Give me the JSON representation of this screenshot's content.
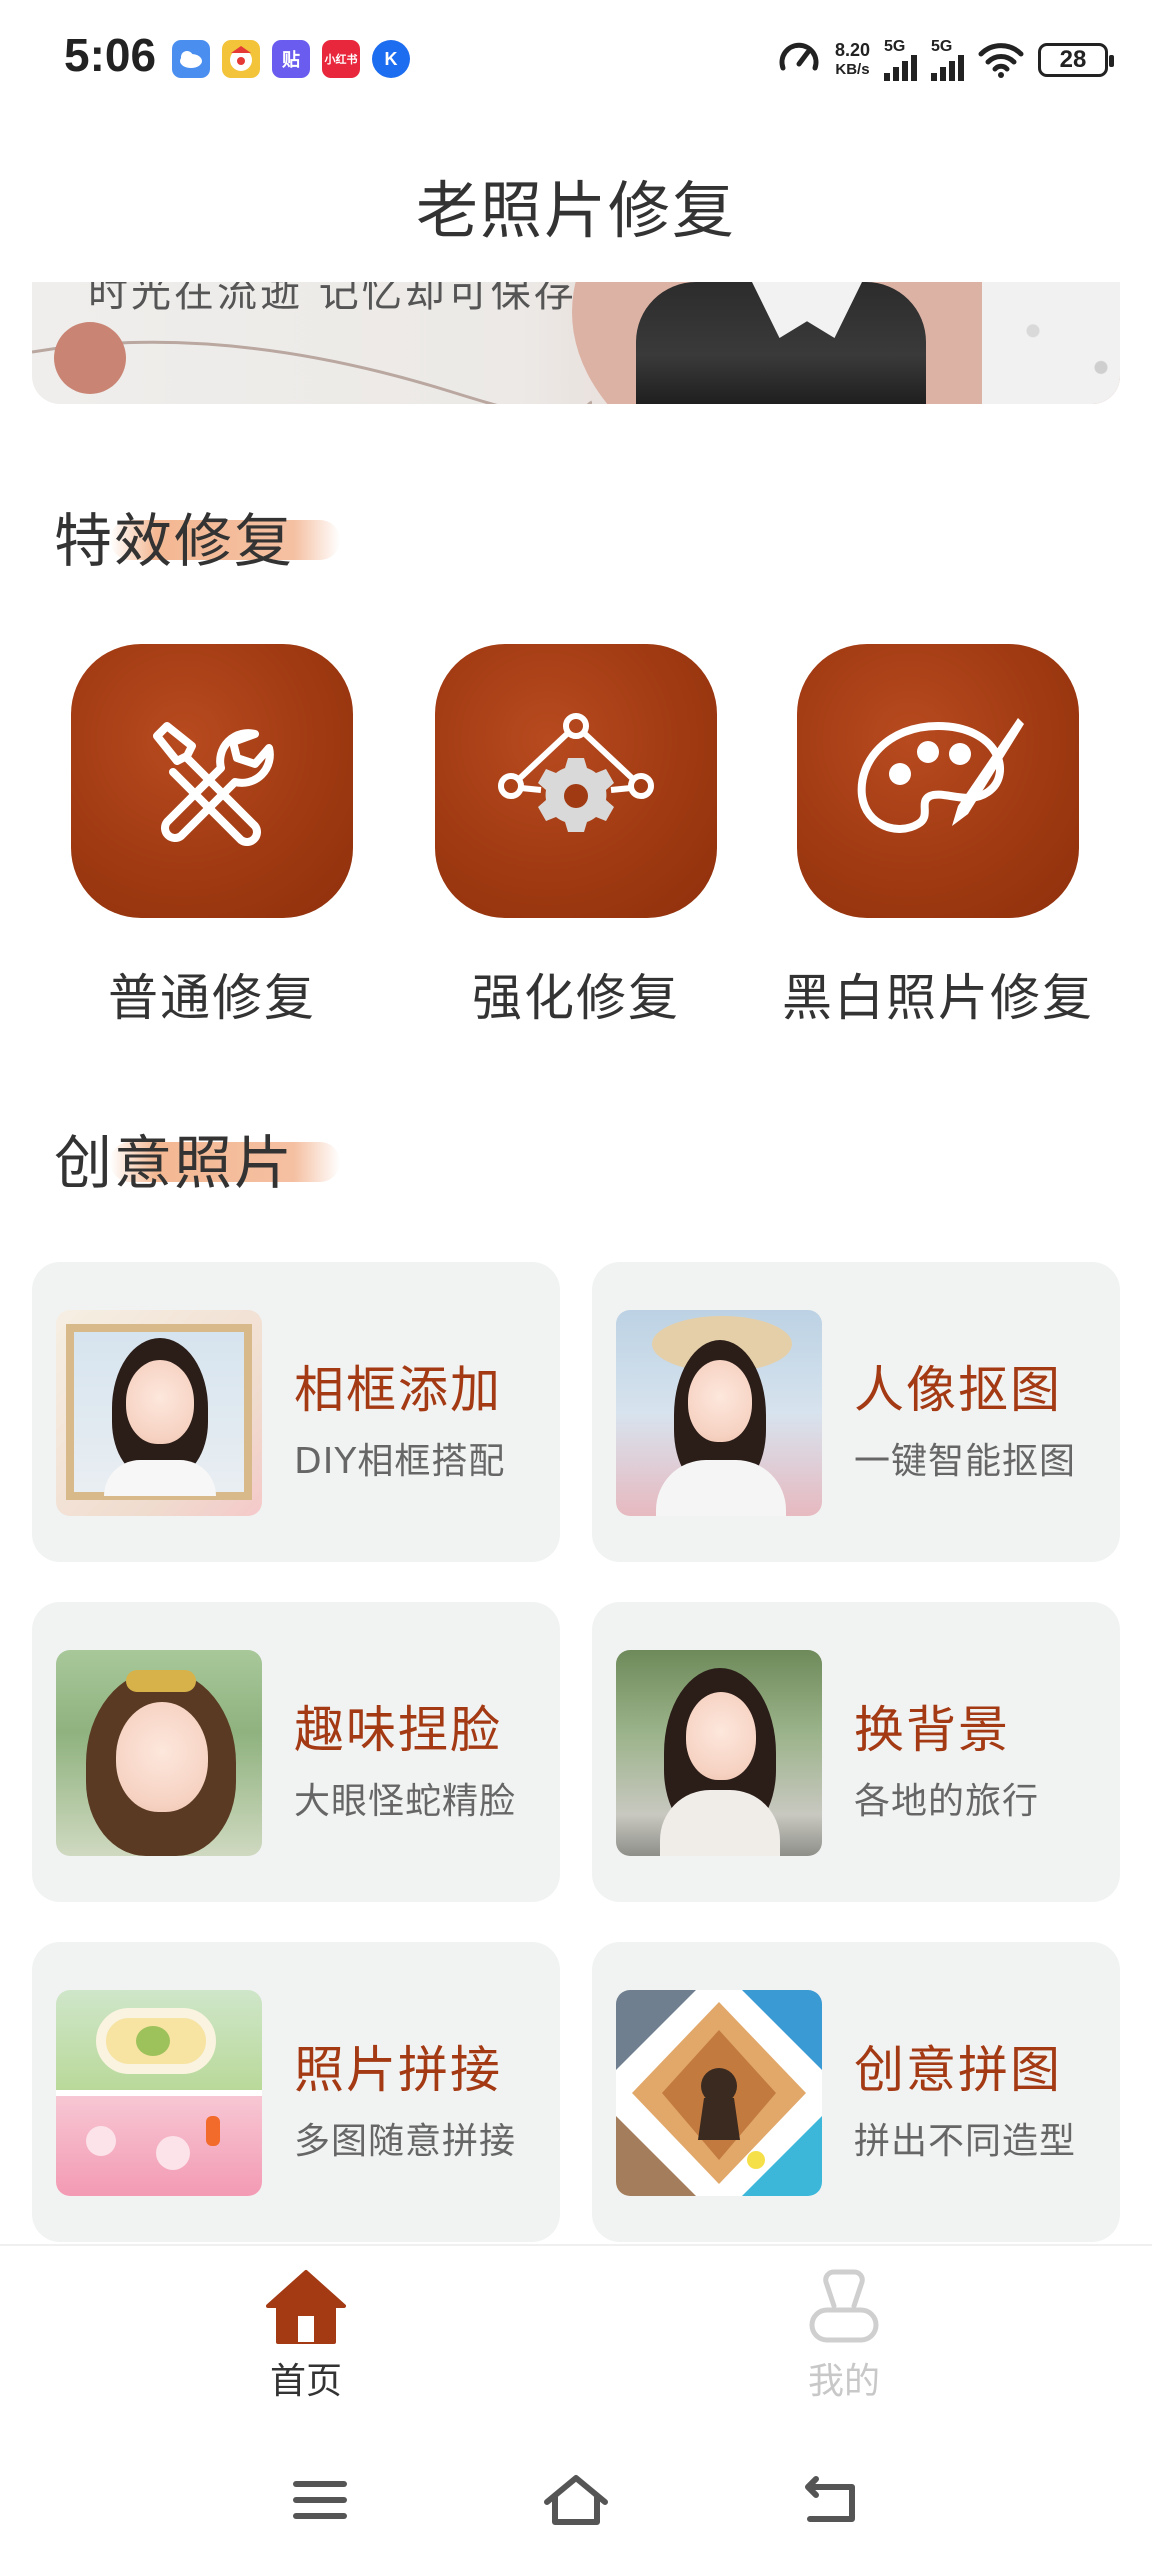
{
  "status_bar": {
    "time": "5:06",
    "net_speed_value": "8.20",
    "net_speed_unit": "KB/s",
    "sim1_label": "5G",
    "sim2_label": "5G",
    "battery": "28",
    "app_icons": [
      "weather-app-icon",
      "clown-app-icon",
      "tieba-app-icon",
      "xiaohongshu-app-icon",
      "k-app-icon"
    ],
    "xhs_icon_text": "小红书",
    "tie_icon_text": "贴",
    "k_icon_text": "K"
  },
  "header": {
    "title": "老照片修复"
  },
  "banner": {
    "text": "时光在流逝 记忆却可保存"
  },
  "sections": {
    "effects_title": "特效修复",
    "creative_title": "创意照片"
  },
  "effects": [
    {
      "label": "普通修复",
      "icon": "tools-icon"
    },
    {
      "label": "强化修复",
      "icon": "gear-network-icon"
    },
    {
      "label": "黑白照片修复",
      "icon": "palette-icon"
    }
  ],
  "cards": [
    {
      "title": "相框添加",
      "subtitle": "DIY相框搭配"
    },
    {
      "title": "人像抠图",
      "subtitle": "一键智能抠图"
    },
    {
      "title": "趣味捏脸",
      "subtitle": "大眼怪蛇精脸"
    },
    {
      "title": "换背景",
      "subtitle": "各地的旅行"
    },
    {
      "title": "照片拼接",
      "subtitle": "多图随意拼接"
    },
    {
      "title": "创意拼图",
      "subtitle": "拼出不同造型"
    }
  ],
  "bottom_nav": [
    {
      "label": "首页",
      "active": true,
      "icon": "home-icon"
    },
    {
      "label": "我的",
      "active": false,
      "icon": "profile-icon"
    }
  ],
  "colors": {
    "accent": "#a33a14",
    "tile": "#a03a12",
    "card_bg": "#f1f2f2",
    "nav_inactive": "#cfcfcf"
  }
}
